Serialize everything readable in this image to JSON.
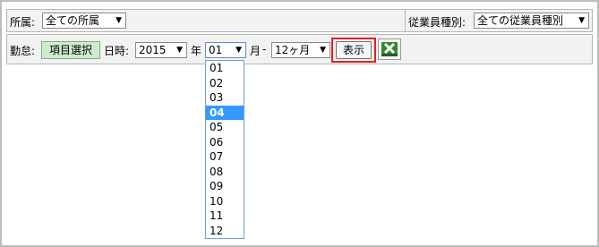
{
  "filters": {
    "affiliation_label": "所属:",
    "affiliation_value": "全ての所属",
    "employee_type_label": "従業員種別:",
    "employee_type_value": "全ての従業員種別"
  },
  "attendance": {
    "label": "勤怠:",
    "item_select_button": "項目選択",
    "datetime_label": "日時:",
    "year_value": "2015",
    "year_unit": "年",
    "month_value": "01",
    "month_unit": "月",
    "dash": "-",
    "period_value": "12ヶ月",
    "show_button": "表示"
  },
  "month_dropdown": {
    "options": [
      "01",
      "02",
      "03",
      "04",
      "05",
      "06",
      "07",
      "08",
      "09",
      "10",
      "11",
      "12"
    ],
    "highlighted": "04"
  },
  "icons": {
    "dropdown_arrow": "▼",
    "excel_export": "excel-icon"
  },
  "colors": {
    "highlight": "#3399ff",
    "show_outline": "#e02020",
    "green_button": "#cfeccf"
  }
}
